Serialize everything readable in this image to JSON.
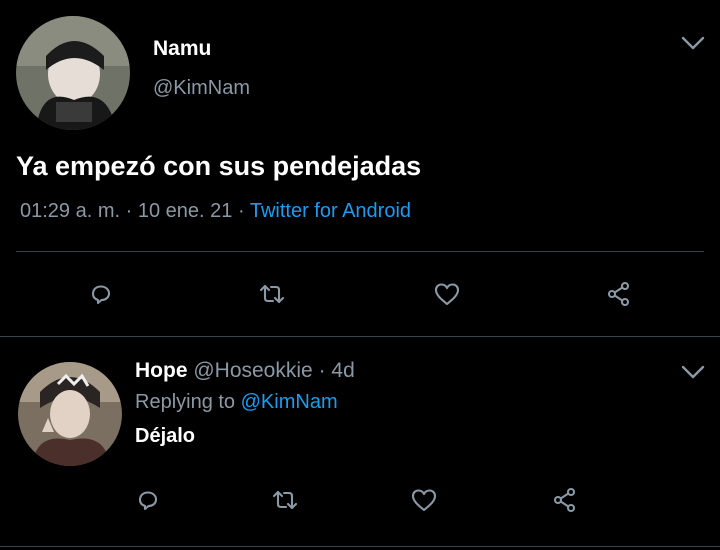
{
  "main_tweet": {
    "author_name": "Namu",
    "handle": "@KimNam",
    "text": "Ya empezó con sus pendejadas",
    "time": "01:29 a. m.",
    "sep1": "·",
    "date": "10 ene. 21",
    "sep2": "·",
    "source": "Twitter for Android"
  },
  "reply": {
    "author_name": "Hope",
    "handle": "@Hoseokkie",
    "sep": "·",
    "age": "4d",
    "replying_label": "Replying to",
    "replying_to": "@KimNam",
    "text": "Déjalo"
  },
  "colors": {
    "background": "#000000",
    "muted": "#8b98a5",
    "accent": "#1d9bf0",
    "divider": "#38444d"
  },
  "icons": [
    "chevron-down-icon",
    "reply-icon",
    "retweet-icon",
    "like-icon",
    "share-icon"
  ]
}
